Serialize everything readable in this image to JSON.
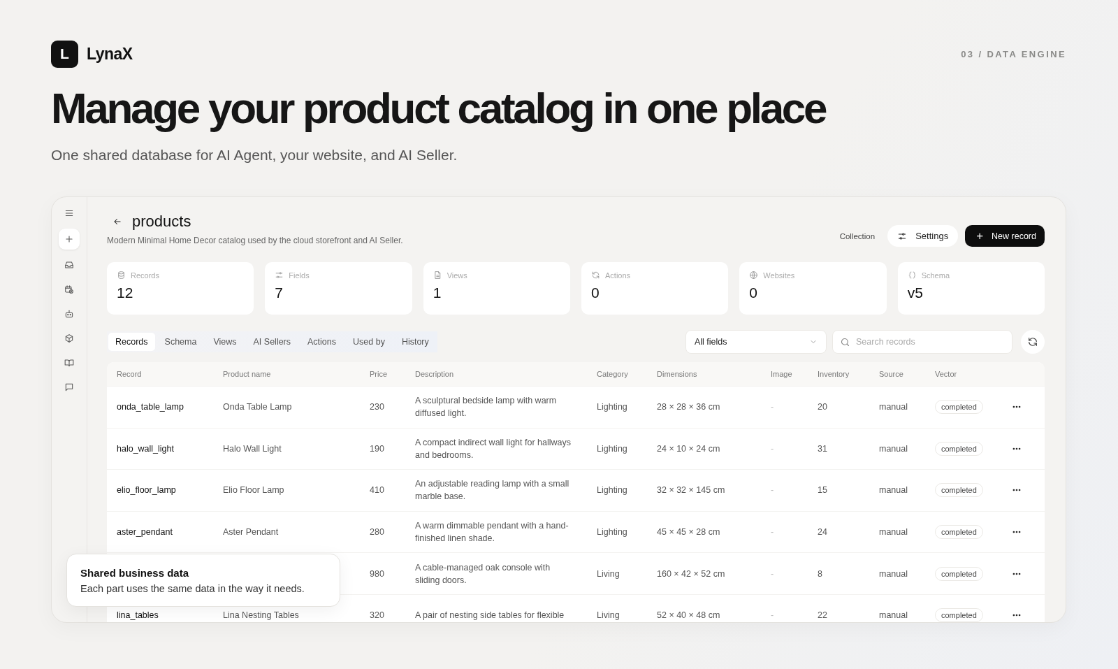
{
  "brand": {
    "logo_letter": "L",
    "name": "LynaX"
  },
  "section_label": "03 / DATA ENGINE",
  "headline": "Manage your product catalog in one place",
  "subheadline": "One shared database for AI Agent, your website, and AI Seller.",
  "app": {
    "title": "products",
    "description": "Modern Minimal Home Decor catalog used by the cloud storefront and AI Seller.",
    "header_actions": {
      "collection": "Collection",
      "settings": "Settings",
      "new_record": "New record",
      "new_record_icon": "+"
    },
    "stats": [
      {
        "label": "Records",
        "value": "12"
      },
      {
        "label": "Fields",
        "value": "7"
      },
      {
        "label": "Views",
        "value": "1"
      },
      {
        "label": "Actions",
        "value": "0"
      },
      {
        "label": "Websites",
        "value": "0"
      },
      {
        "label": "Schema",
        "value": "v5"
      }
    ],
    "tabs": [
      {
        "label": "Records",
        "selected": true
      },
      {
        "label": "Schema",
        "selected": false
      },
      {
        "label": "Views",
        "selected": false
      },
      {
        "label": "AI Sellers",
        "selected": false
      },
      {
        "label": "Actions",
        "selected": false
      },
      {
        "label": "Used by",
        "selected": false
      },
      {
        "label": "History",
        "selected": false
      }
    ],
    "filter": {
      "value": "All fields"
    },
    "search": {
      "placeholder": "Search records"
    },
    "table": {
      "columns": [
        "Record",
        "Product name",
        "Price",
        "Description",
        "Category",
        "Dimensions",
        "Image",
        "Inventory",
        "Source",
        "Vector"
      ],
      "rows": [
        {
          "record": "onda_table_lamp",
          "product_name": "Onda Table Lamp",
          "price": "230",
          "description": "A sculptural bedside lamp with warm diffused light.",
          "category": "Lighting",
          "dimensions": "28 × 28 × 36 cm",
          "image": "-",
          "inventory": "20",
          "source": "manual",
          "vector": "completed"
        },
        {
          "record": "halo_wall_light",
          "product_name": "Halo Wall Light",
          "price": "190",
          "description": "A compact indirect wall light for hallways and bedrooms.",
          "category": "Lighting",
          "dimensions": "24 × 10 × 24 cm",
          "image": "-",
          "inventory": "31",
          "source": "manual",
          "vector": "completed"
        },
        {
          "record": "elio_floor_lamp",
          "product_name": "Elio Floor Lamp",
          "price": "410",
          "description": "An adjustable reading lamp with a small marble base.",
          "category": "Lighting",
          "dimensions": "32 × 32 × 145 cm",
          "image": "-",
          "inventory": "15",
          "source": "manual",
          "vector": "completed"
        },
        {
          "record": "aster_pendant",
          "product_name": "Aster Pendant",
          "price": "280",
          "description": "A warm dimmable pendant with a hand-finished linen shade.",
          "category": "Lighting",
          "dimensions": "45 × 45 × 28 cm",
          "image": "-",
          "inventory": "24",
          "source": "manual",
          "vector": "completed"
        },
        {
          "price": "980",
          "description": "A cable-managed oak console with sliding doors.",
          "category": "Living",
          "dimensions": "160 × 42 × 52 cm",
          "image": "-",
          "inventory": "8",
          "source": "manual",
          "vector": "completed"
        },
        {
          "record": "lina_tables",
          "product_name": "Lina Nesting Tables",
          "price": "320",
          "description": "A pair of nesting side tables for flexible",
          "category": "Living",
          "dimensions": "52 × 40 × 48 cm",
          "image": "-",
          "inventory": "22",
          "source": "manual",
          "vector": "completed"
        }
      ]
    }
  },
  "callout": {
    "title": "Shared business data",
    "text": "Each part uses the same data in the way it needs."
  }
}
